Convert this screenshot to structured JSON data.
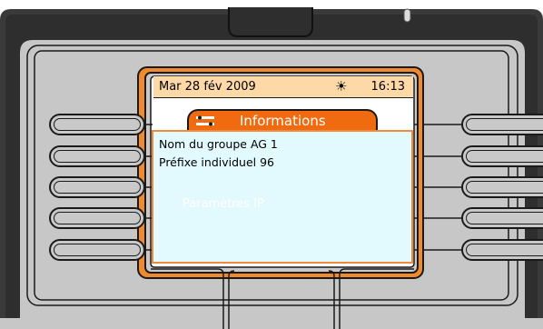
{
  "status_bar": {
    "date": "Mar 28 fév 2009",
    "weather_icon": "sun-icon",
    "time": "16:13"
  },
  "title_bar": {
    "icon": "tools-icon",
    "title": "Informations"
  },
  "content": {
    "lines": [
      "Nom du groupe AG 1",
      "Préfixe individuel 96",
      "Paramètres IP"
    ]
  },
  "colors": {
    "accent": "#f06a10",
    "status_bar_bg": "#fdd9a8",
    "content_bg": "#e2fafd",
    "body": "#c7c7c7"
  }
}
